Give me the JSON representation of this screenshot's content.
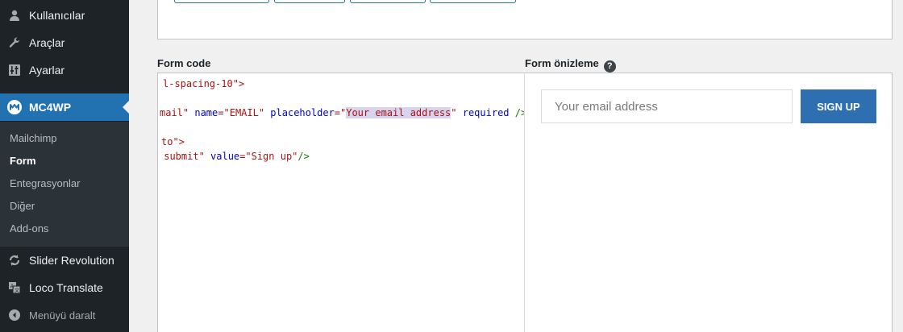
{
  "sidebar": {
    "items": [
      {
        "label": "Kullanıcılar",
        "icon": "users-icon"
      },
      {
        "label": "Araçlar",
        "icon": "wrench-icon"
      },
      {
        "label": "Ayarlar",
        "icon": "settings-icon"
      },
      {
        "label": "MC4WP",
        "icon": "mc4wp-icon",
        "current": true
      },
      {
        "label": "Slider Revolution",
        "icon": "refresh-icon"
      },
      {
        "label": "Loco Translate",
        "icon": "translate-icon"
      }
    ],
    "submenu": [
      "Mailchimp",
      "Form",
      "Entegrasyonlar",
      "Diğer",
      "Add-ons"
    ],
    "submenu_active": "Form",
    "collapse_label": "Menüyü daralt"
  },
  "labels": {
    "form_code": "Form code",
    "form_preview": "Form önizleme",
    "help": "?"
  },
  "code": {
    "line1": "l-spacing-10\">",
    "line2_a": "mail\" ",
    "line2_b": "name",
    "line2_c": "=\"EMAIL\" ",
    "line2_d": "placeholder",
    "line2_e": "=\"",
    "line2_sel": "Your email address",
    "line2_f": "\" ",
    "line2_g": "required",
    "line2_h": " />",
    "line3": "to\">",
    "line4_a": " submit\" ",
    "line4_b": "value",
    "line4_c": "=\"Sign up\"",
    "line4_d": "/>"
  },
  "preview": {
    "email_placeholder": "Your email address",
    "signup_label": "SIGN UP"
  },
  "colors": {
    "sidebar_bg": "#1d2327",
    "submenu_bg": "#2c3338",
    "accent": "#2271b1",
    "button": "#2e6fb2"
  }
}
